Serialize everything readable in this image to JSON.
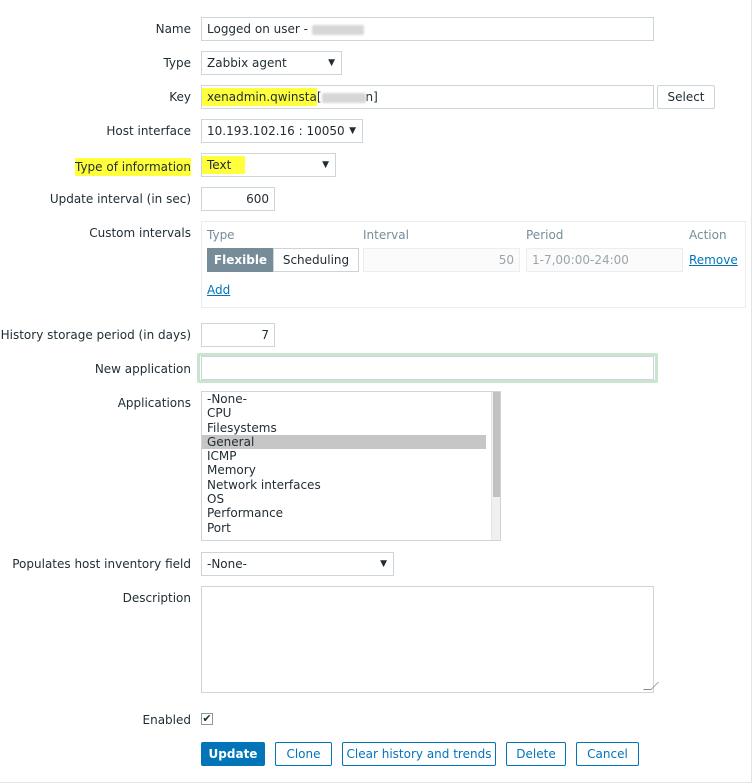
{
  "form": {
    "name": {
      "label": "Name",
      "value": "Logged on user -"
    },
    "type": {
      "label": "Type",
      "value": "Zabbix agent"
    },
    "key": {
      "label": "Key",
      "value_prefix": "xenadmin.qwinsta",
      "value_open": "[",
      "value_suffix": "n]",
      "select_label": "Select"
    },
    "host_interface": {
      "label": "Host interface",
      "value": "10.193.102.16 : 10050"
    },
    "type_of_info": {
      "label": "Type of information",
      "value": "Text"
    },
    "update_interval": {
      "label": "Update interval (in sec)",
      "value": "600"
    },
    "custom_intervals": {
      "label": "Custom intervals",
      "headers": {
        "type": "Type",
        "interval": "Interval",
        "period": "Period",
        "action": "Action"
      },
      "row": {
        "flexible": "Flexible",
        "scheduling": "Scheduling",
        "interval": "50",
        "period": "1-7,00:00-24:00",
        "remove": "Remove"
      },
      "add": "Add"
    },
    "history": {
      "label": "History storage period (in days)",
      "value": "7"
    },
    "new_application": {
      "label": "New application",
      "value": ""
    },
    "applications": {
      "label": "Applications",
      "options": [
        "-None-",
        "CPU",
        "Filesystems",
        "General",
        "ICMP",
        "Memory",
        "Network interfaces",
        "OS",
        "Performance",
        "Port"
      ],
      "selected": "General"
    },
    "inventory": {
      "label": "Populates host inventory field",
      "value": "-None-"
    },
    "description": {
      "label": "Description",
      "value": ""
    },
    "enabled": {
      "label": "Enabled",
      "checked": true,
      "checkmark": "✔"
    }
  },
  "actions": {
    "update": "Update",
    "clone": "Clone",
    "clear": "Clear history and trends",
    "delete": "Delete",
    "cancel": "Cancel"
  },
  "icons": {
    "caret": "▼"
  },
  "colors": {
    "highlight": "#ffff3c",
    "primary": "#0275b8",
    "focus": "#c9e4cf"
  }
}
